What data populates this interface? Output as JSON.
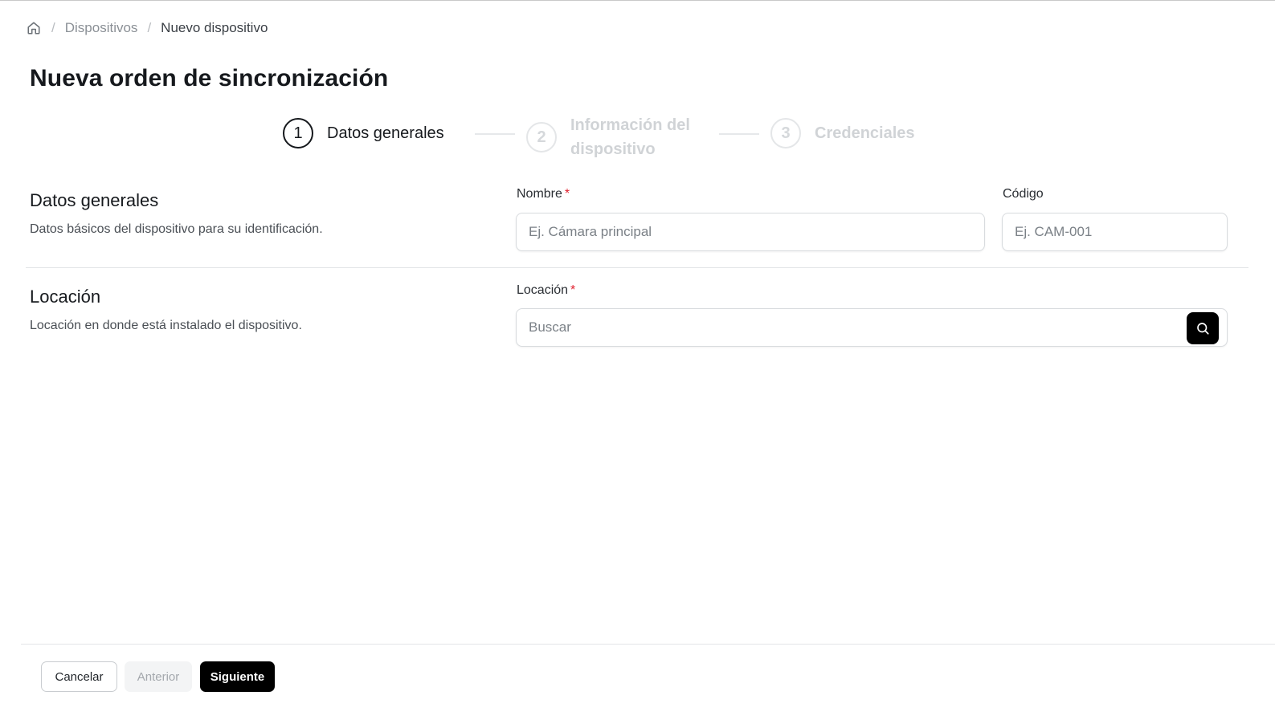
{
  "breadcrumb": {
    "home_icon": "home-icon",
    "items": [
      "Dispositivos",
      "Nuevo dispositivo"
    ],
    "separator": "/"
  },
  "page": {
    "title": "Nueva orden de sincronización"
  },
  "stepper": {
    "steps": [
      {
        "number": "1",
        "label": "Datos generales",
        "state": "active"
      },
      {
        "number": "2",
        "label": "Información del dispositivo",
        "state": "inactive"
      },
      {
        "number": "3",
        "label": "Credenciales",
        "state": "inactive"
      }
    ]
  },
  "sections": {
    "general": {
      "title": "Datos generales",
      "description": "Datos básicos del dispositivo para su identificación.",
      "name_field": {
        "label": "Nombre",
        "required_mark": "*",
        "placeholder": "Ej. Cámara principal",
        "value": ""
      },
      "code_field": {
        "label": "Código",
        "placeholder": "Ej. CAM-001",
        "value": ""
      }
    },
    "location": {
      "title": "Locación",
      "description": "Locación en donde está instalado el dispositivo.",
      "location_field": {
        "label": "Locación",
        "required_mark": "*",
        "placeholder": "Buscar",
        "value": "",
        "search_icon": "search-icon"
      }
    }
  },
  "footer": {
    "cancel_label": "Cancelar",
    "previous_label": "Anterior",
    "next_label": "Siguiente"
  },
  "colors": {
    "primary": "#000000",
    "required": "#e0202e",
    "inactive_step": "#d0d3d6"
  }
}
